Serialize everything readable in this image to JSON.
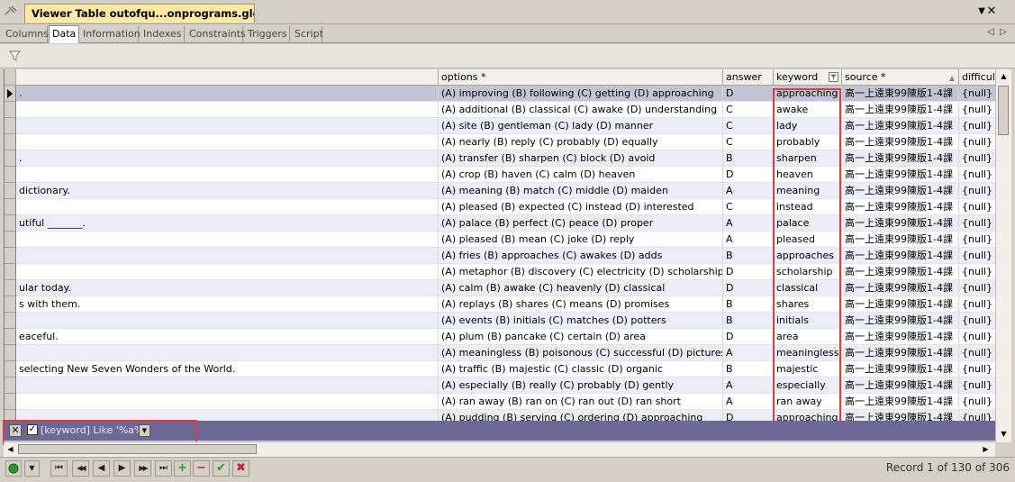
{
  "window": {
    "title": "Viewer Table outofqu...onprograms.glossary",
    "pin_icon": "pin-icon",
    "dropdown_glyph": "▼",
    "close_glyph": "✕"
  },
  "tabs": [
    {
      "label": "Columns"
    },
    {
      "label": "Data"
    },
    {
      "label": "Information"
    },
    {
      "label": "Indexes"
    },
    {
      "label": "Constraints"
    },
    {
      "label": "Triggers"
    },
    {
      "label": "Script"
    }
  ],
  "tab_nav": {
    "prev": "◁",
    "next": "▷"
  },
  "columns": [
    {
      "label": ""
    },
    {
      "label": "options *"
    },
    {
      "label": "answer"
    },
    {
      "label": "keyword"
    },
    {
      "label": "source *"
    },
    {
      "label": "difficult"
    }
  ],
  "rows": [
    {
      "question": ".",
      "options": "(A) improving   (B) following   (C) getting   (D) approaching",
      "answer": "D",
      "keyword": "approaching",
      "source": "高一上遠東99陳版1-4課",
      "difficulty": "{null}"
    },
    {
      "question": "",
      "options": "(A) additional   (B) classical   (C) awake   (D) understanding",
      "answer": "C",
      "keyword": "awake",
      "source": "高一上遠東99陳版1-4課",
      "difficulty": "{null}"
    },
    {
      "question": "",
      "options": "(A) site   (B) gentleman   (C) lady   (D) manner",
      "answer": "C",
      "keyword": "lady",
      "source": "高一上遠東99陳版1-4課",
      "difficulty": "{null}"
    },
    {
      "question": "",
      "options": "(A) nearly   (B) reply   (C) probably   (D) equally",
      "answer": "C",
      "keyword": "probably",
      "source": "高一上遠東99陳版1-4課",
      "difficulty": "{null}"
    },
    {
      "question": ".",
      "options": "(A) transfer   (B) sharpen   (C) block   (D) avoid",
      "answer": "B",
      "keyword": "sharpen",
      "source": "高一上遠東99陳版1-4課",
      "difficulty": "{null}"
    },
    {
      "question": "",
      "options": "(A) crop   (B) haven   (C) calm   (D) heaven",
      "answer": "D",
      "keyword": "heaven",
      "source": "高一上遠東99陳版1-4課",
      "difficulty": "{null}"
    },
    {
      "question": "dictionary.",
      "options": "(A) meaning   (B) match   (C) middle   (D) maiden",
      "answer": "A",
      "keyword": "meaning",
      "source": "高一上遠東99陳版1-4課",
      "difficulty": "{null}"
    },
    {
      "question": "",
      "options": "(A) pleased   (B) expected   (C) instead   (D) interested",
      "answer": "C",
      "keyword": "instead",
      "source": "高一上遠東99陳版1-4課",
      "difficulty": "{null}"
    },
    {
      "question": "utiful _______.",
      "options": "(A) palace   (B) perfect   (C) peace   (D) proper",
      "answer": "A",
      "keyword": "palace",
      "source": "高一上遠東99陳版1-4課",
      "difficulty": "{null}"
    },
    {
      "question": "",
      "options": "(A) pleased   (B) mean   (C) joke   (D) reply",
      "answer": "A",
      "keyword": "pleased",
      "source": "高一上遠東99陳版1-4課",
      "difficulty": "{null}"
    },
    {
      "question": "",
      "options": "(A) fries   (B) approaches   (C) awakes   (D) adds",
      "answer": "B",
      "keyword": "approaches",
      "source": "高一上遠東99陳版1-4課",
      "difficulty": "{null}"
    },
    {
      "question": "",
      "options": "(A) metaphor   (B) discovery   (C) electricity   (D) scholarship",
      "answer": "D",
      "keyword": "scholarship",
      "source": "高一上遠東99陳版1-4課",
      "difficulty": "{null}"
    },
    {
      "question": "ular today.",
      "options": "(A) calm   (B) awake   (C) heavenly   (D) classical",
      "answer": "D",
      "keyword": "classical",
      "source": "高一上遠東99陳版1-4課",
      "difficulty": "{null}"
    },
    {
      "question": "s with them.",
      "options": "(A) replays   (B) shares   (C) means   (D) promises",
      "answer": "B",
      "keyword": "shares",
      "source": "高一上遠東99陳版1-4課",
      "difficulty": "{null}"
    },
    {
      "question": "",
      "options": "(A) events   (B) initials   (C) matches   (D) potters",
      "answer": "B",
      "keyword": "initials",
      "source": "高一上遠東99陳版1-4課",
      "difficulty": "{null}"
    },
    {
      "question": "eaceful.",
      "options": "(A) plum   (B) pancake   (C) certain   (D) area",
      "answer": "D",
      "keyword": "area",
      "source": "高一上遠東99陳版1-4課",
      "difficulty": "{null}"
    },
    {
      "question": "",
      "options": "(A) meaningless   (B) poisonous   (C) successful   (D) picturesque",
      "answer": "A",
      "keyword": "meaningless",
      "source": "高一上遠東99陳版1-4課",
      "difficulty": "{null}"
    },
    {
      "question": "selecting New Seven Wonders of the World.",
      "options": "(A) traffic   (B) majestic   (C) classic   (D) organic",
      "answer": "B",
      "keyword": "majestic",
      "source": "高一上遠東99陳版1-4課",
      "difficulty": "{null}"
    },
    {
      "question": "",
      "options": "(A) especially   (B) really   (C) probably   (D) gently",
      "answer": "A",
      "keyword": "especially",
      "source": "高一上遠東99陳版1-4課",
      "difficulty": "{null}"
    },
    {
      "question": "",
      "options": "(A) ran away   (B) ran on   (C) ran out   (D) ran short",
      "answer": "A",
      "keyword": "ran away",
      "source": "高一上遠東99陳版1-4課",
      "difficulty": "{null}"
    },
    {
      "question": "",
      "options": "(A) pudding   (B) serving   (C) ordering   (D) approaching",
      "answer": "D",
      "keyword": "approaching",
      "source": "高一上遠東99陳版1-4課",
      "difficulty": "{null}"
    }
  ],
  "filter": {
    "close_glyph": "✕",
    "check_glyph": "✓",
    "expression": "[keyword] Like '%a%'",
    "dropdown_glyph": "▼"
  },
  "scroll": {
    "up": "▲",
    "down": "▼",
    "left": "◀",
    "right": "▶"
  },
  "nav_buttons": [
    {
      "name": "nav-first-button",
      "label": "⏮"
    },
    {
      "name": "nav-prev-page-button",
      "label": "◀◀"
    },
    {
      "name": "nav-prev-button",
      "label": "◀"
    },
    {
      "name": "nav-next-button",
      "label": "▶"
    },
    {
      "name": "nav-next-page-button",
      "label": "▶▶"
    },
    {
      "name": "nav-last-button",
      "label": "⏭"
    },
    {
      "name": "nav-add-button",
      "label": "+"
    },
    {
      "name": "nav-delete-button",
      "label": "−"
    },
    {
      "name": "nav-apply-button",
      "label": "✔"
    },
    {
      "name": "nav-cancel-button",
      "label": "✖"
    }
  ],
  "status": {
    "text": "Record 1 of 130  of 306"
  },
  "colors": {
    "nav_green": "#2a9a2a",
    "nav_red": "#cc2222",
    "highlight_red": "#d8403c",
    "filter_bar": "#6e6897"
  }
}
